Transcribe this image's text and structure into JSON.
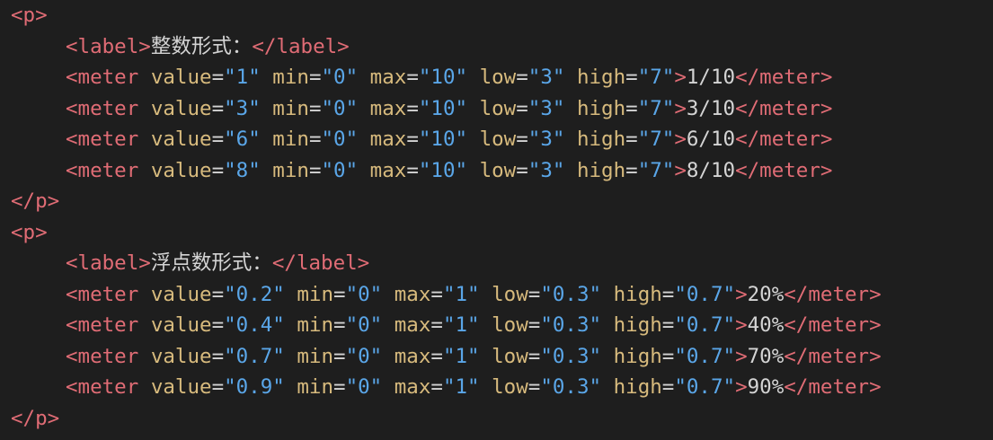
{
  "theme": {
    "background": "#1e1e1e",
    "tag_color": "#e06c75",
    "attr_name_color": "#d7ba7d",
    "attr_value_color": "#5aa6e8",
    "text_color": "#d4d4d4"
  },
  "code": {
    "p1_open": "p",
    "label1_tag": "label",
    "label1_text": "整数形式：",
    "int_meters": [
      {
        "value": "\"1\"",
        "min": "\"0\"",
        "max": "\"10\"",
        "low": "\"3\"",
        "high": "\"7\"",
        "text": "1/10"
      },
      {
        "value": "\"3\"",
        "min": "\"0\"",
        "max": "\"10\"",
        "low": "\"3\"",
        "high": "\"7\"",
        "text": "3/10"
      },
      {
        "value": "\"6\"",
        "min": "\"0\"",
        "max": "\"10\"",
        "low": "\"3\"",
        "high": "\"7\"",
        "text": "6/10"
      },
      {
        "value": "\"8\"",
        "min": "\"0\"",
        "max": "\"10\"",
        "low": "\"3\"",
        "high": "\"7\"",
        "text": "8/10"
      }
    ],
    "p1_close": "p",
    "p2_open": "p",
    "label2_tag": "label",
    "label2_text": "浮点数形式：",
    "float_meters": [
      {
        "value": "\"0.2\"",
        "min": "\"0\"",
        "max": "\"1\"",
        "low": "\"0.3\"",
        "high": "\"0.7\"",
        "text": "20%"
      },
      {
        "value": "\"0.4\"",
        "min": "\"0\"",
        "max": "\"1\"",
        "low": "\"0.3\"",
        "high": "\"0.7\"",
        "text": "40%"
      },
      {
        "value": "\"0.7\"",
        "min": "\"0\"",
        "max": "\"1\"",
        "low": "\"0.3\"",
        "high": "\"0.7\"",
        "text": "70%"
      },
      {
        "value": "\"0.9\"",
        "min": "\"0\"",
        "max": "\"1\"",
        "low": "\"0.3\"",
        "high": "\"0.7\"",
        "text": "90%"
      }
    ],
    "p2_close": "p",
    "meter_tag": "meter",
    "attr_names": {
      "value": "value",
      "min": "min",
      "max": "max",
      "low": "low",
      "high": "high"
    }
  }
}
